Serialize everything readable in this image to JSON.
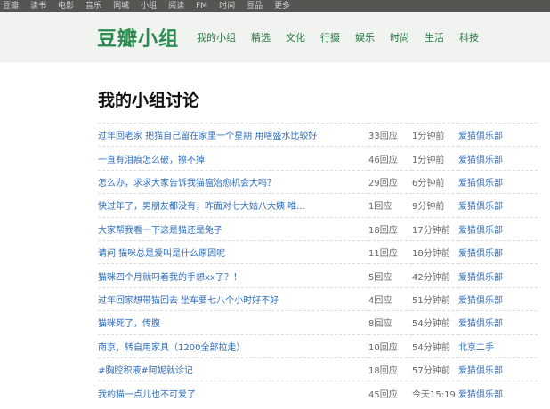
{
  "global_nav": [
    "豆瓣",
    "读书",
    "电影",
    "音乐",
    "同城",
    "小组",
    "阅读",
    "FM",
    "时间",
    "豆品",
    "更多"
  ],
  "header": {
    "logo": "豆瓣小组",
    "nav": [
      "我的小组",
      "精选",
      "文化",
      "行摄",
      "娱乐",
      "时尚",
      "生活",
      "科技"
    ]
  },
  "page": {
    "title": "我的小组讨论"
  },
  "topics": [
    {
      "title": "过年回老家 把猫自己留在家里一个星期 用啥盛水比较好",
      "replies": "33回应",
      "time": "1分钟前",
      "group": "爱猫俱乐部"
    },
    {
      "title": "一直有泪痕怎么破，擦不掉",
      "replies": "46回应",
      "time": "1分钟前",
      "group": "爱猫俱乐部"
    },
    {
      "title": "怎么办，求求大家告诉我猫瘟治愈机会大吗？",
      "replies": "29回应",
      "time": "6分钟前",
      "group": "爱猫俱乐部"
    },
    {
      "title": "快过年了，男朋友都没有，昨面对七大姑八大姨 唯...",
      "replies": "1回应",
      "time": "9分钟前",
      "group": "爱猫俱乐部"
    },
    {
      "title": "大家帮我看一下这是猫还是兔子",
      "replies": "18回应",
      "time": "17分钟前",
      "group": "爱猫俱乐部"
    },
    {
      "title": "请问 猫咪总是爱叫是什么原因呢",
      "replies": "11回应",
      "time": "18分钟前",
      "group": "爱猫俱乐部"
    },
    {
      "title": "猫咪四个月就叼着我的手想xx了？！",
      "replies": "5回应",
      "time": "42分钟前",
      "group": "爱猫俱乐部"
    },
    {
      "title": "过年回家想带猫回去 坐车要七八个小时好不好",
      "replies": "4回应",
      "time": "51分钟前",
      "group": "爱猫俱乐部"
    },
    {
      "title": "猫咪死了，传腹",
      "replies": "8回应",
      "time": "54分钟前",
      "group": "爱猫俱乐部"
    },
    {
      "title": "南京，转自用家具（1200全部拉走）",
      "replies": "10回应",
      "time": "54分钟前",
      "group": "北京二手"
    },
    {
      "title": "#胸腔积液#阿妮就诊记",
      "replies": "18回应",
      "time": "57分钟前",
      "group": "爱猫俱乐部"
    },
    {
      "title": "我的猫一点儿也不可爱了",
      "replies": "45回应",
      "time": "今天15:19",
      "group": "爱猫俱乐部"
    }
  ]
}
